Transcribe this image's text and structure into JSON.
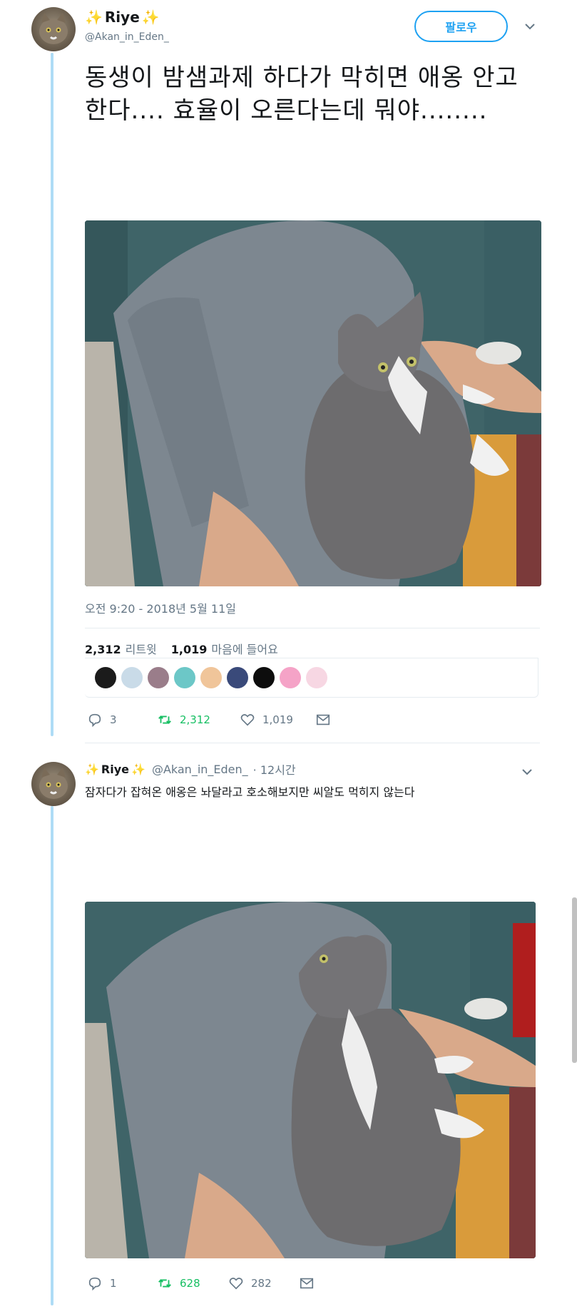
{
  "tweet1": {
    "author": {
      "sparkle_left": "✨",
      "name": "Riye",
      "sparkle_right": "✨",
      "handle": "@Akan_in_Eden_"
    },
    "follow_label": "팔로우",
    "text_line1": "동생이 밤샘과제 하다가 막히면 애옹 안고",
    "text_line2": "한다.... 효율이 오른다는데 뭐야........",
    "timestamp": "오전 9:20 - 2018년 5월 11일",
    "retweets_count": "2,312",
    "retweets_label": "리트윗",
    "likes_count": "1,019",
    "likes_label": "마음에 들어요",
    "actions": {
      "reply": "3",
      "retweet": "2,312",
      "like": "1,019"
    },
    "liker_colors": [
      "#1b1b1b",
      "#c9dbe8",
      "#9a7d8a",
      "#6cc7c7",
      "#f0c59a",
      "#3a4a7a",
      "#0d0d0d",
      "#f5a3c7",
      "#f7d7e3"
    ]
  },
  "tweet2": {
    "author": {
      "sparkle_left": "✨",
      "name": "Riye",
      "sparkle_right": "✨",
      "handle": "@Akan_in_Eden_",
      "time": "· 12시간"
    },
    "text": "잠자다가 잡혀온 애옹은 놔달라고 호소해보지만 씨알도 먹히지 않는다",
    "actions": {
      "reply": "1",
      "retweet": "628",
      "like": "282"
    }
  },
  "colors": {
    "accent": "#1da1f2",
    "retweet_green": "#17bf63",
    "thread_line": "#aedcf6"
  }
}
